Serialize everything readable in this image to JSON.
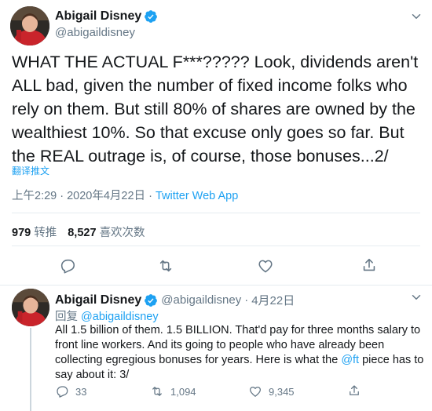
{
  "main_tweet": {
    "author": {
      "display_name": "Abigail Disney",
      "handle": "@abigaildisney",
      "avatar_icon": "profile-photo",
      "verified_icon": "verified-badge-icon"
    },
    "text": "WHAT THE ACTUAL F***?????  Look, dividends aren't ALL bad, given the number of fixed income folks who rely on them.  But still 80% of shares are owned by the wealthiest 10%.  So that excuse only goes so far.  But the REAL outrage is, of course, those bonuses...2/",
    "translate_label": "翻译推文",
    "timestamp": "上午2:29 · 2020年4月22日 · ",
    "source_app": "Twitter Web App",
    "retweets": {
      "count": "979",
      "label": "转推"
    },
    "likes": {
      "count": "8,527",
      "label": "喜欢次数"
    },
    "actions": [
      {
        "name": "reply",
        "icon": "reply-icon"
      },
      {
        "name": "retweet",
        "icon": "retweet-icon"
      },
      {
        "name": "like",
        "icon": "heart-icon"
      },
      {
        "name": "share",
        "icon": "share-icon"
      }
    ]
  },
  "reply_tweet": {
    "author": {
      "display_name": "Abigail Disney",
      "handle": "@abigaildisney",
      "separator": "·",
      "date": "4月22日"
    },
    "replying_to_label": "回复",
    "replying_to_handle": "@abigaildisney",
    "text_before_mention": "All 1.5 billion of them.  1.5 BILLION.  That'd pay for three months salary to front line workers.  And its going to people who have already been collecting egregious bonuses for years. Here is what the ",
    "mention": "@ft",
    "text_after_mention": " piece has to say about it: 3/",
    "reply_count": "33",
    "retweet_count": "1,094",
    "like_count": "9,345"
  },
  "colors": {
    "accent": "#1da1f2",
    "text_primary": "#14171a",
    "text_secondary": "#657786",
    "divider": "#e6ecf0"
  }
}
